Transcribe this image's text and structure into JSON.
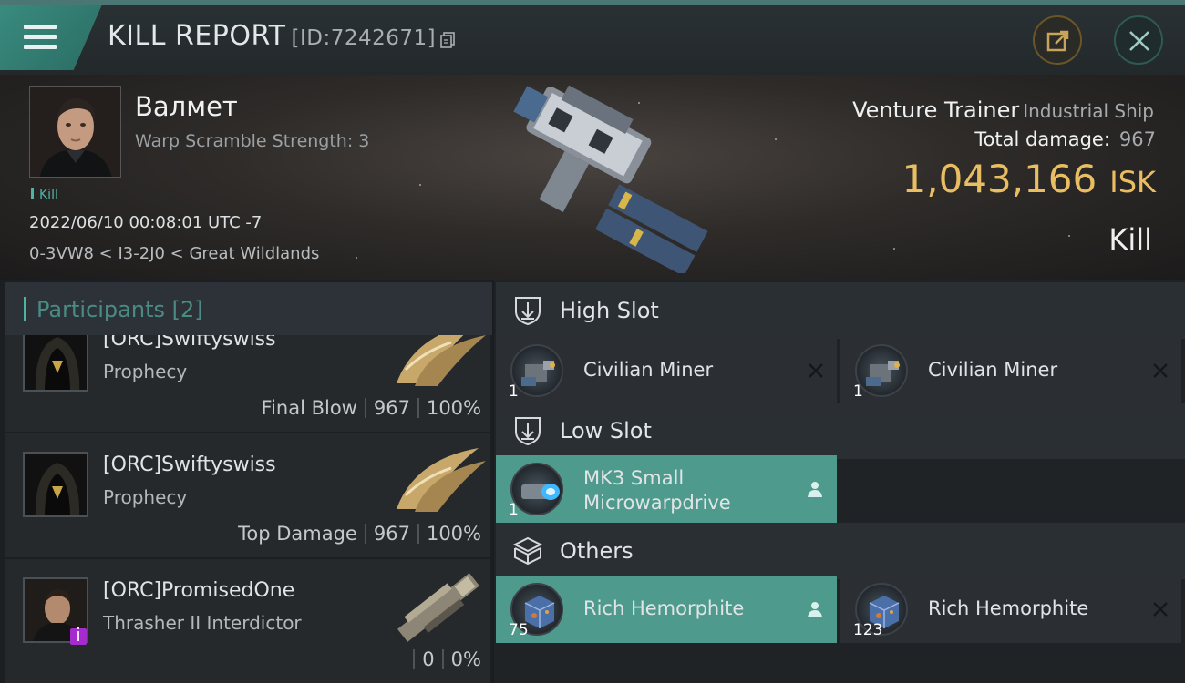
{
  "header": {
    "title": "KILL REPORT",
    "report_id": "[ID:7242671]",
    "menu_icon": "hamburger-icon",
    "share_icon": "share-icon",
    "close_icon": "close-icon"
  },
  "victim": {
    "name": "Валмет",
    "warp_scramble": "Warp Scramble Strength: 3",
    "tag": "Kill",
    "datetime": "2022/06/10 00:08:01 UTC -7",
    "location": "0-3VW8 < I3-2J0 < Great Wildlands"
  },
  "ship": {
    "name": "Venture Trainer",
    "class": "Industrial Ship",
    "total_damage_label": "Total damage:",
    "total_damage_value": "967",
    "isk_value": "1,043,166",
    "isk_unit": "ISK",
    "result": "Kill"
  },
  "participants": {
    "header": "Participants [2]",
    "rows": [
      {
        "name": "[ORC]Swiftyswiss",
        "ship": "Prophecy",
        "role": "Final Blow",
        "damage": "967",
        "percent": "100%"
      },
      {
        "name": "[ORC]Swiftyswiss",
        "ship": "Prophecy",
        "role": "Top Damage",
        "damage": "967",
        "percent": "100%"
      },
      {
        "name": "[ORC]PromisedOne",
        "ship": "Thrasher II Interdictor",
        "role": "",
        "damage": "0",
        "percent": "0%"
      }
    ]
  },
  "fitting": {
    "high_slot": {
      "title": "High Slot",
      "modules": [
        {
          "name": "Civilian Miner",
          "qty": "1"
        },
        {
          "name": "Civilian Miner",
          "qty": "1"
        }
      ]
    },
    "low_slot": {
      "title": "Low Slot",
      "modules": [
        {
          "name_line1": "MK3 Small",
          "name_line2": "Microwarpdrive",
          "qty": "1"
        }
      ]
    },
    "others": {
      "title": "Others",
      "modules": [
        {
          "name": "Rich Hemorphite",
          "qty": "75"
        },
        {
          "name": "Rich Hemorphite",
          "qty": "123"
        }
      ]
    }
  },
  "colors": {
    "accent_teal": "#4fb3a4",
    "isk_gold": "#e9bd62",
    "fitted_bg": "#4e9b8d"
  }
}
